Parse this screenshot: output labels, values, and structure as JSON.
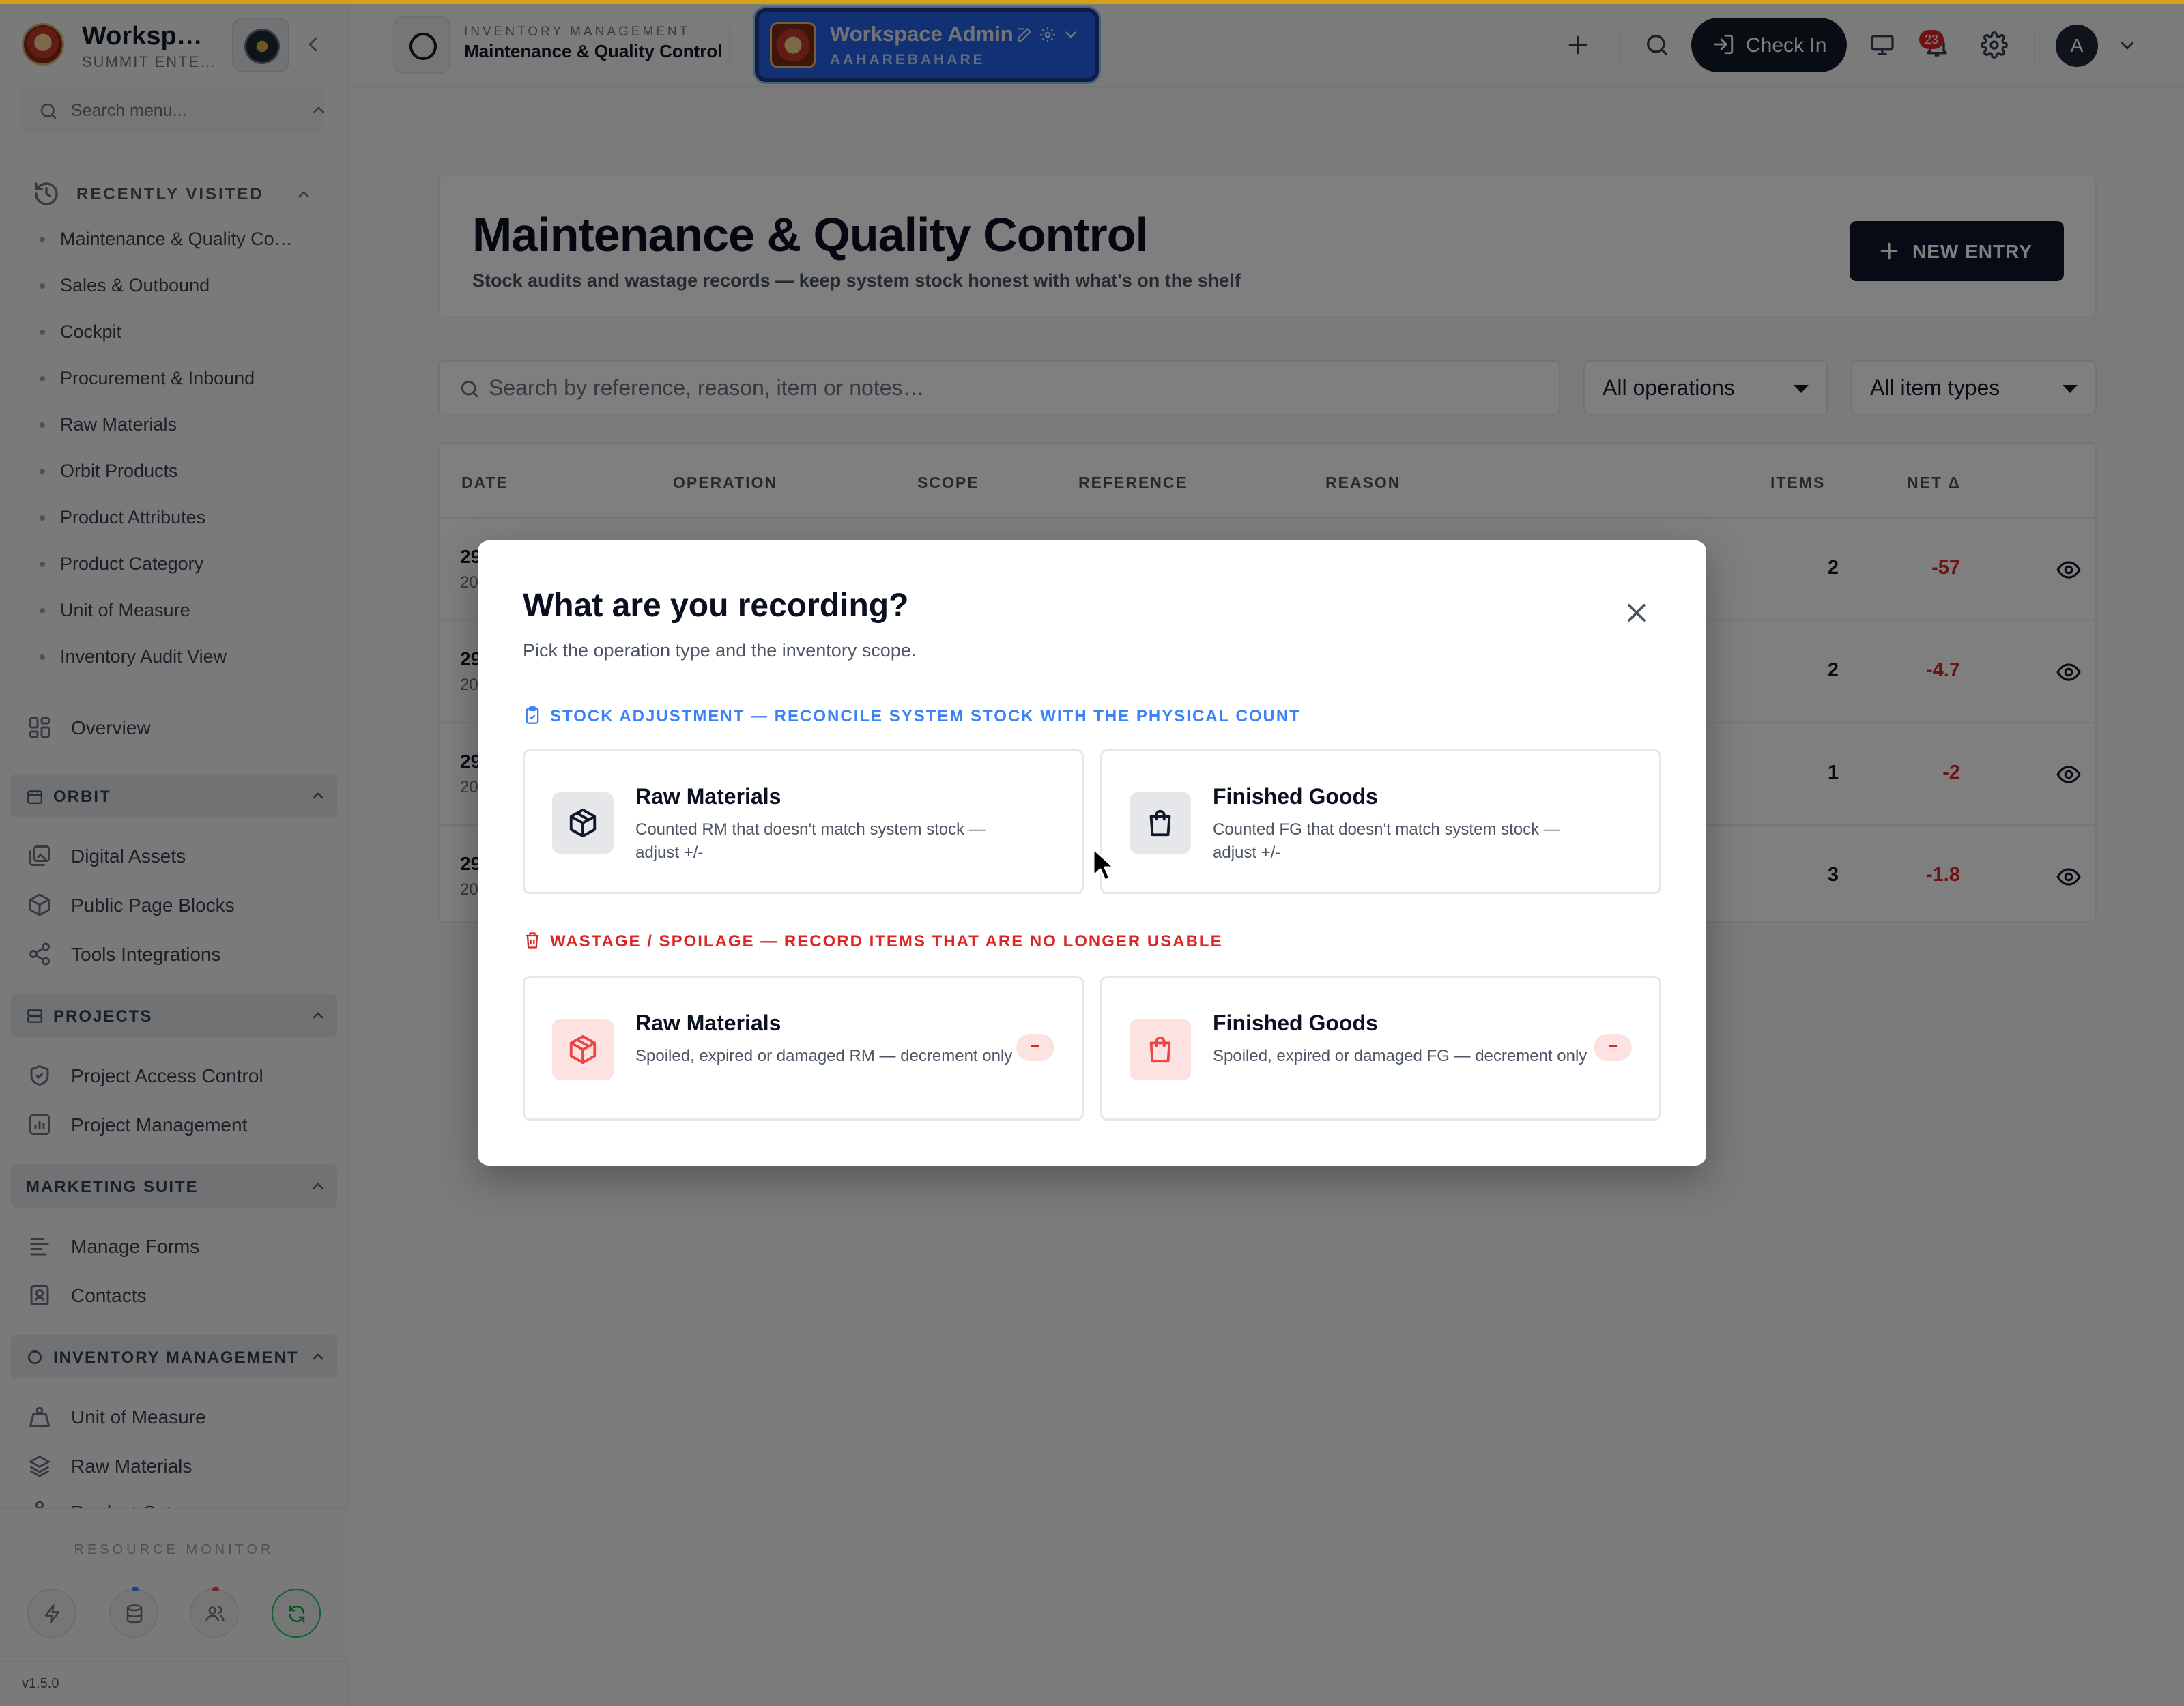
{
  "sidebar": {
    "org_name": "Worksp…",
    "org_sub": "SUMMIT ENTE…",
    "search_placeholder": "Search menu...",
    "recently_visited_label": "RECENTLY VISITED",
    "recent": [
      "Maintenance & Quality Co…",
      "Sales & Outbound",
      "Cockpit",
      "Procurement & Inbound",
      "Raw Materials",
      "Orbit Products",
      "Product Attributes",
      "Product Category",
      "Unit of Measure",
      "Inventory Audit View"
    ],
    "overview_label": "Overview",
    "sections": {
      "orbit": {
        "label": "ORBIT",
        "items": [
          "Digital Assets",
          "Public Page Blocks",
          "Tools Integrations"
        ]
      },
      "projects": {
        "label": "PROJECTS",
        "items": [
          "Project Access Control",
          "Project Management"
        ]
      },
      "marketing": {
        "label": "MARKETING SUITE",
        "items": [
          "Manage Forms",
          "Contacts"
        ]
      },
      "inventory": {
        "label": "INVENTORY MANAGEMENT",
        "items": [
          "Unit of Measure",
          "Raw Materials",
          "Product Category"
        ]
      }
    },
    "resource_monitor_label": "RESOURCE MONITOR",
    "version": "v1.5.0"
  },
  "topbar": {
    "module_kicker": "INVENTORY MANAGEMENT",
    "module_title": "Maintenance & Quality Control",
    "workspace_name": "Workspace Admin",
    "workspace_sub": "AAHAREBAHARE",
    "check_in_label": "Check In",
    "notification_count": "23",
    "avatar_initial": "A"
  },
  "main": {
    "title": "Maintenance & Quality Control",
    "subtitle": "Stock audits and wastage records — keep system stock honest with what's on the shelf",
    "new_entry_label": "NEW ENTRY",
    "search_placeholder": "Search by reference, reason, item or notes…",
    "operation_filter": "All operations",
    "item_type_filter": "All item types",
    "table": {
      "columns": {
        "date": "DATE",
        "operation": "OPERATION",
        "scope": "SCOPE",
        "reference": "REFERENCE",
        "reason": "REASON",
        "items": "ITEMS",
        "net": "NET Δ"
      },
      "rows": [
        {
          "date": "29",
          "year": "20",
          "items": "2",
          "net": "-57"
        },
        {
          "date": "29",
          "year": "20",
          "items": "2",
          "net": "-4.7"
        },
        {
          "date": "29",
          "year": "20",
          "items": "1",
          "net": "-2"
        },
        {
          "date": "29",
          "year": "20",
          "items": "3",
          "net": "-1.8"
        }
      ]
    }
  },
  "modal": {
    "title": "What are you recording?",
    "subtitle": "Pick the operation type and the inventory scope.",
    "stock_adjustment": {
      "heading": "STOCK ADJUSTMENT — RECONCILE SYSTEM STOCK WITH THE PHYSICAL COUNT",
      "raw": {
        "title": "Raw Materials",
        "desc": "Counted RM that doesn't match system stock — adjust +/-"
      },
      "finished": {
        "title": "Finished Goods",
        "desc": "Counted FG that doesn't match system stock — adjust +/-"
      }
    },
    "wastage": {
      "heading": "WASTAGE / SPOILAGE — RECORD ITEMS THAT ARE NO LONGER USABLE",
      "raw": {
        "title": "Raw Materials",
        "desc": "Spoiled, expired or damaged RM — decrement only",
        "badge": "−"
      },
      "finished": {
        "title": "Finished Goods",
        "desc": "Spoiled, expired or damaged FG — decrement only",
        "badge": "−"
      }
    }
  }
}
